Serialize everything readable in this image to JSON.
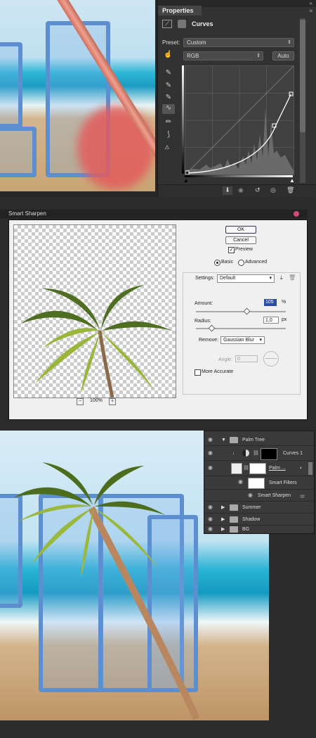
{
  "properties": {
    "tab_title": "Properties",
    "panel_title": "Curves",
    "preset_label": "Preset:",
    "preset_value": "Custom",
    "channel_value": "RGB",
    "auto_label": "Auto"
  },
  "smart_sharpen": {
    "title": "Smart Sharpen",
    "ok_label": "OK",
    "cancel_label": "Cancel",
    "preview_label": "Preview",
    "mode_basic": "Basic",
    "mode_advanced": "Advanced",
    "settings_label": "Settings:",
    "settings_value": "Default",
    "amount_label": "Amount:",
    "amount_value": "105",
    "amount_unit": "%",
    "radius_label": "Radius:",
    "radius_value": "1,0",
    "radius_unit": "px",
    "remove_label": "Remove:",
    "remove_value": "Gaussian Blur",
    "angle_label": "Angle:",
    "angle_value": "0",
    "more_accurate_label": "More Accurate",
    "zoom_value": "100%",
    "zoom_minus": "−",
    "zoom_plus": "+"
  },
  "layers": {
    "items": [
      {
        "name": "Palm Tree",
        "type": "group"
      },
      {
        "name": "Curves 1",
        "type": "adjustment"
      },
      {
        "name": "Palm ...",
        "type": "smart-object"
      },
      {
        "name": "Smart Filters",
        "type": "filters"
      },
      {
        "name": "Smart Sharpen",
        "type": "filter"
      },
      {
        "name": "Summer",
        "type": "group"
      },
      {
        "name": "Shadow",
        "type": "group"
      },
      {
        "name": "BG",
        "type": "group"
      }
    ]
  },
  "colors": {
    "accent_red": "#e25c5c",
    "panel_bg": "#323232",
    "dialog_bg": "#f0f0f0"
  }
}
